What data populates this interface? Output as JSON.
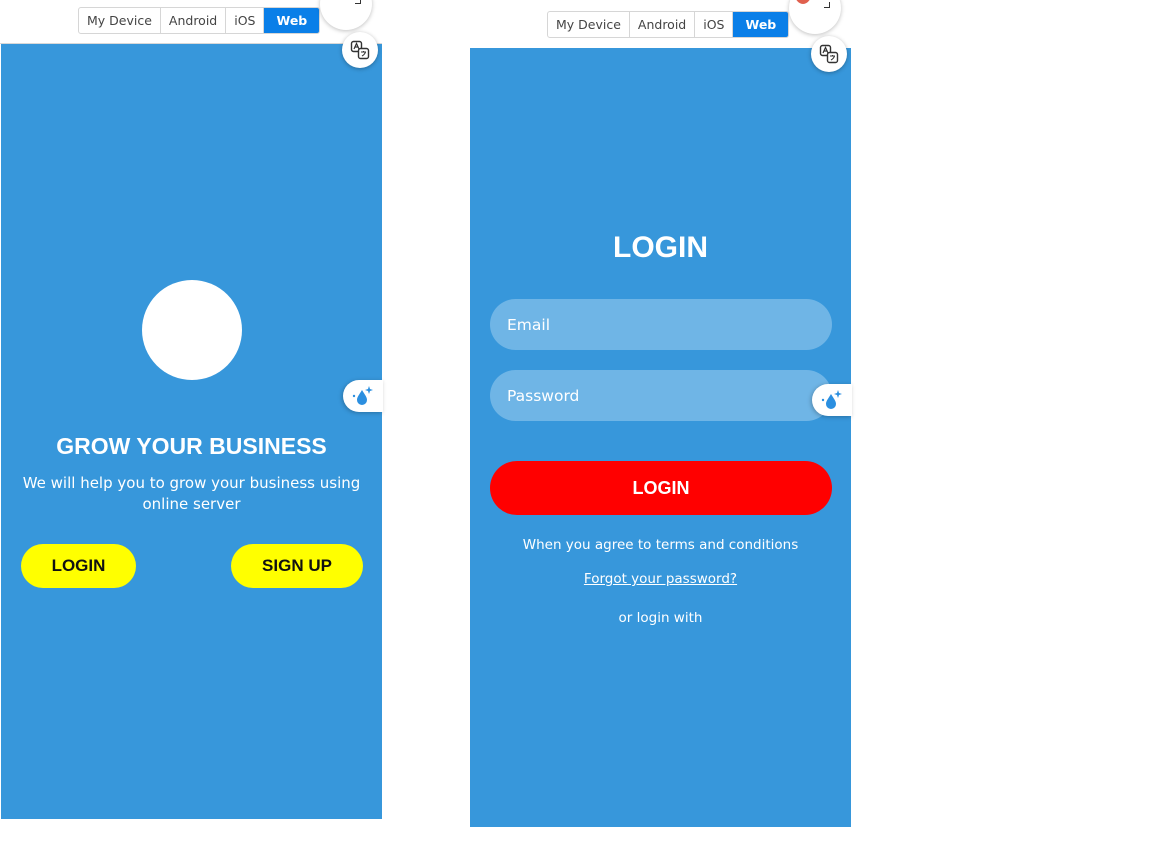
{
  "device_switcher": {
    "options": [
      "My Device",
      "Android",
      "iOS",
      "Web"
    ],
    "selected": "Web"
  },
  "icons": {
    "translate": "translate-icon",
    "drop": "water-drop-sparkle-icon",
    "extension": "extension-logo-icon"
  },
  "welcome_screen": {
    "headline": "GROW YOUR BUSINESS",
    "subtext": "We will help you to grow your business using online server",
    "login_button": "LOGIN",
    "signup_button": "SIGN UP"
  },
  "login_screen": {
    "title": "LOGIN",
    "email_placeholder": "Email",
    "password_placeholder": "Password",
    "login_button": "LOGIN",
    "terms_text": "When you agree to terms and conditions",
    "forgot_password": "Forgot your password?",
    "alt_login_text": "or login with"
  },
  "colors": {
    "screen_background": "#3797db",
    "input_background": "#6fb5e6",
    "primary_button": "#ff0000",
    "secondary_button": "#ffff00",
    "switcher_active": "#0a7fe8"
  }
}
